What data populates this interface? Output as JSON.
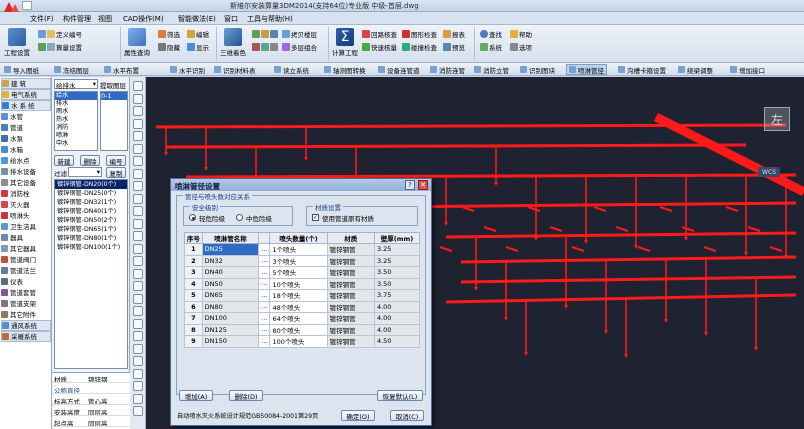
{
  "window": {
    "title": "斯维尔安装算量3DM2014(支持64位)专业版    中级-首层.dwg"
  },
  "menu": [
    "文件(F)",
    "构件管理",
    "视图",
    "CAD操作(M)",
    "智能做法(E)",
    "窗口",
    "工具与帮助(H)"
  ],
  "ribbon": {
    "big": [
      "工程设置",
      "属性查询",
      "三维着色",
      "计算工程"
    ],
    "small": [
      [
        "定义编号",
        "算量设置"
      ],
      [
        "筛选",
        "隐藏"
      ],
      [
        "编辑",
        "显示"
      ],
      [
        "拷贝楼层",
        "多层组合"
      ],
      [
        "回路核查",
        "快速核量"
      ],
      [
        "图形检查",
        "碰撞检查"
      ],
      [
        "报表",
        "预览"
      ],
      [
        "查找",
        "系统"
      ],
      [
        "帮助",
        "选项"
      ]
    ]
  },
  "toolbar2": [
    "导入图纸",
    "冻结图层",
    "水平布置",
    "水平识别",
    "识别材料表",
    "读立系统",
    "轴测图转换",
    "设备连管道",
    "消防连管",
    "消防立管",
    "识别图块",
    "喷淋管径",
    "沟槽卡箍设置",
    "绕梁调整",
    "增加接口"
  ],
  "toolbar2_selected": "喷淋管径",
  "leftnav": {
    "items": [
      "建 筑",
      "电气系统",
      "水 系 统",
      "水管",
      "管道",
      "水泵",
      "水箱",
      "给水点",
      "排水设备",
      "其它设备",
      "消防栓",
      "灭火器",
      "喷淋头",
      "卫生洁具",
      "器具",
      "其它器具",
      "管道阀门",
      "管道法兰",
      "仪表",
      "管道套管",
      "管道支架",
      "其它附件",
      "通风系统",
      "采暖系统"
    ]
  },
  "midpanel": {
    "combo1": "给排水",
    "combo1_label": "提取图层",
    "list1": [
      "给水",
      "排水",
      "雨水",
      "热水",
      "消防",
      "喷淋",
      "中水"
    ],
    "list1_right": "0-1",
    "buttons": [
      "新建",
      "删除",
      "编号"
    ],
    "filter_label": "过滤",
    "copy_btn": "复制",
    "pipes": [
      "镀锌钢管-DN20(0个)",
      "镀锌钢管-DN25(0个)",
      "镀锌钢管-DN32(1个)",
      "镀锌钢管-DN40(1个)",
      "镀锌钢管-DN50(2个)",
      "镀锌钢管-DN65(1个)",
      "镀锌钢管-DN80(1个)",
      "镀锌钢管-DN100(1个)"
    ]
  },
  "props": [
    [
      "材质",
      "镀锌钢"
    ],
    [
      "公称直径",
      ""
    ],
    [
      "标高方式",
      "管心高"
    ],
    [
      "安装高度",
      "同层高"
    ],
    [
      "起点高",
      "同层高"
    ]
  ],
  "canvas": {
    "view_label": "左",
    "wcs": "WCS"
  },
  "dialog": {
    "title": "喷淋管径设置",
    "group_main": "管径与喷头数对应关系",
    "group_safety": "安全级别",
    "radio_light": "轻危险级",
    "radio_mid": "中危险级",
    "group_material": "材质设置",
    "check_material": "使用管道原有材质",
    "columns": [
      "序号",
      "喷淋管名称",
      "",
      "喷头数量(个)",
      "材质",
      "壁厚(mm)"
    ],
    "rows": [
      [
        "1",
        "DN25",
        "",
        "1个喷头",
        "镀锌钢管",
        "3.25"
      ],
      [
        "2",
        "DN32",
        "",
        "3个喷头",
        "镀锌钢管",
        "3.25"
      ],
      [
        "3",
        "DN40",
        "",
        "5个喷头",
        "镀锌钢管",
        "3.50"
      ],
      [
        "4",
        "DN50",
        "",
        "10个喷头",
        "镀锌钢管",
        "3.50"
      ],
      [
        "5",
        "DN65",
        "",
        "18个喷头",
        "镀锌钢管",
        "3.75"
      ],
      [
        "6",
        "DN80",
        "",
        "48个喷头",
        "镀锌钢管",
        "4.00"
      ],
      [
        "7",
        "DN100",
        "",
        "64个喷头",
        "镀锌钢管",
        "4.00"
      ],
      [
        "8",
        "DN125",
        "",
        "80个喷头",
        "镀锌钢管",
        "4.00"
      ],
      [
        "9",
        "DN150",
        "",
        "100个喷头",
        "镀锌钢管",
        "4.50"
      ]
    ],
    "btn_add": "增加(A)",
    "btn_delete": "删除(D)",
    "btn_restore": "恢复默认(L)",
    "footnote": "自动喷水灭火系统设计规范GB50084-2001第29页",
    "btn_ok": "确定(O)",
    "btn_cancel": "取消(C)"
  },
  "colors": {
    "pipe": "#ff1a1a",
    "canvas_bg": "#1f2230",
    "dialog_title": "#93aed8"
  }
}
